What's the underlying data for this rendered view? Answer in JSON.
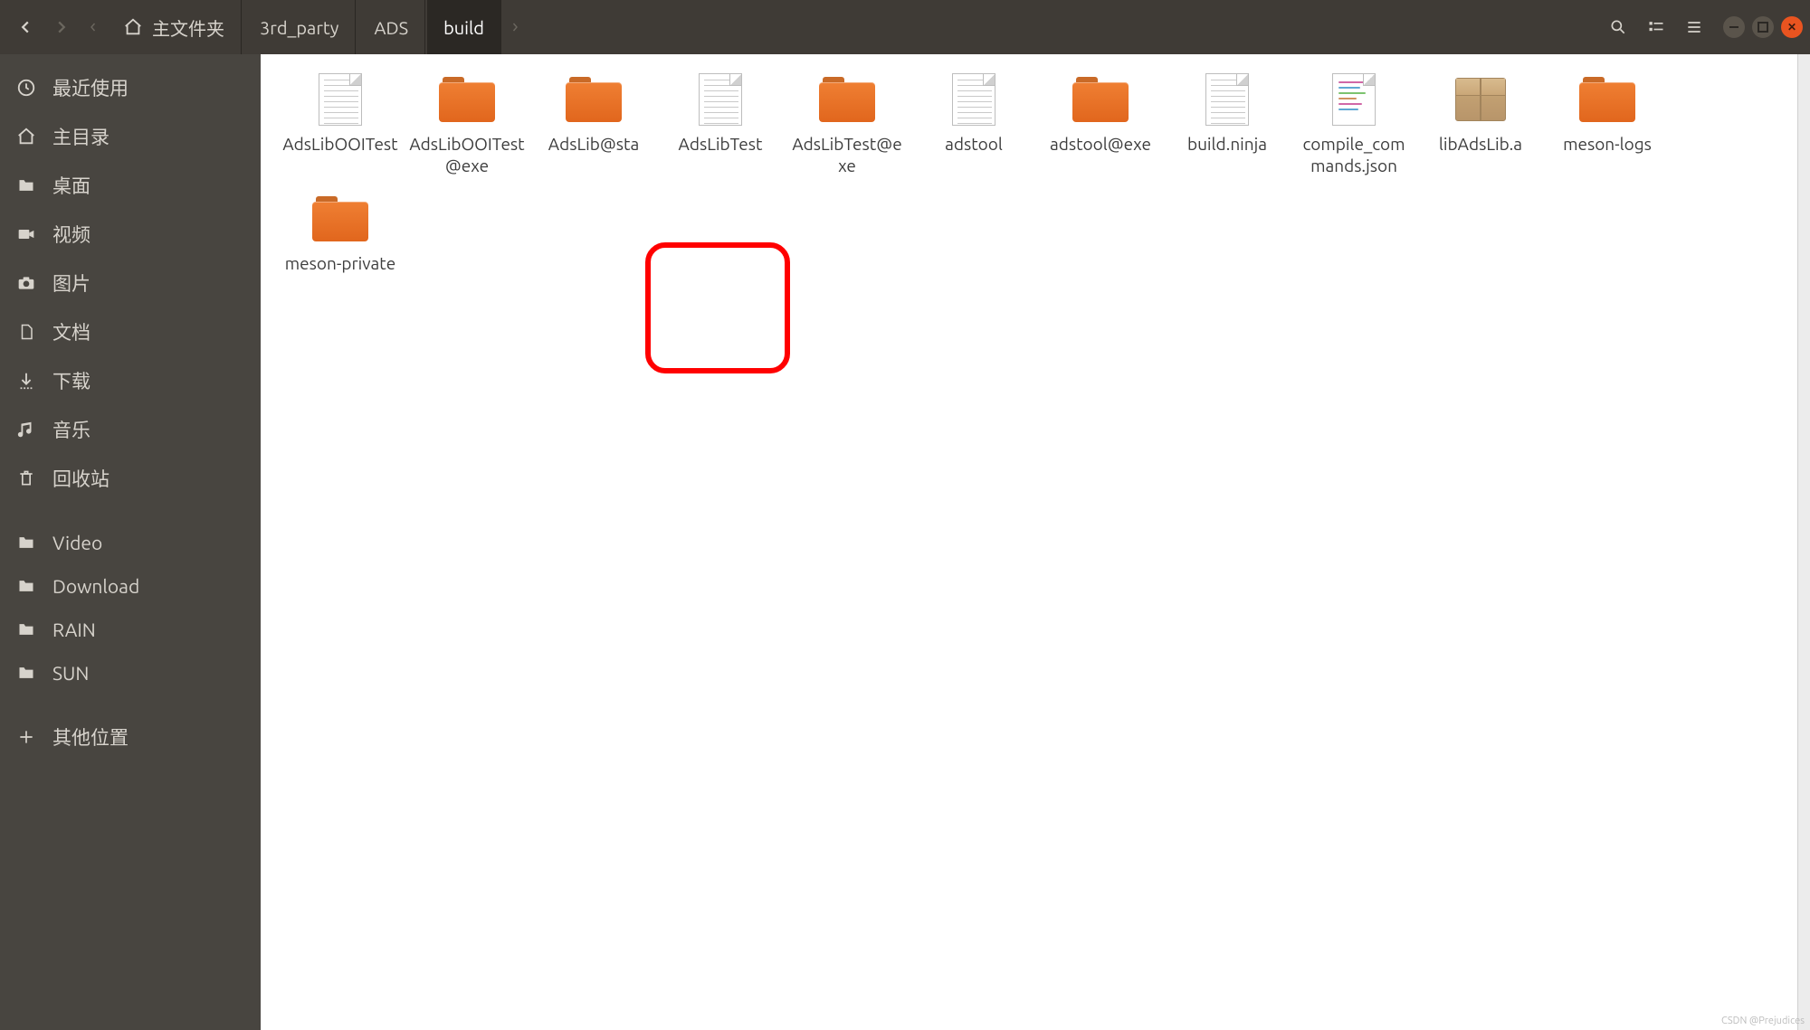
{
  "header": {
    "home_label": "主文件夹",
    "crumbs": [
      "3rd_party",
      "ADS",
      "build"
    ]
  },
  "sidebar": {
    "items": [
      {
        "icon": "recent",
        "label": "最近使用"
      },
      {
        "icon": "home",
        "label": "主目录"
      },
      {
        "icon": "folder",
        "label": "桌面"
      },
      {
        "icon": "video",
        "label": "视频"
      },
      {
        "icon": "camera",
        "label": "图片"
      },
      {
        "icon": "doc",
        "label": "文档"
      },
      {
        "icon": "download",
        "label": "下载"
      },
      {
        "icon": "music",
        "label": "音乐"
      },
      {
        "icon": "trash",
        "label": "回收站"
      }
    ],
    "items2": [
      {
        "icon": "folder",
        "label": "Video"
      },
      {
        "icon": "folder",
        "label": "Download"
      },
      {
        "icon": "folder",
        "label": "RAIN"
      },
      {
        "icon": "folder",
        "label": "SUN"
      }
    ],
    "other": {
      "icon": "plus",
      "label": "其他位置"
    }
  },
  "content": {
    "items": [
      {
        "type": "text",
        "label": "AdsLibOOITest"
      },
      {
        "type": "folder",
        "label": "AdsLibOOITest@exe"
      },
      {
        "type": "folder",
        "label": "AdsLib@sta"
      },
      {
        "type": "text",
        "label": "AdsLibTest"
      },
      {
        "type": "folder",
        "label": "AdsLibTest@exe"
      },
      {
        "type": "text",
        "label": "adstool"
      },
      {
        "type": "folder",
        "label": "adstool@exe"
      },
      {
        "type": "text",
        "label": "build.ninja"
      },
      {
        "type": "textcolor",
        "label": "compile_commands.json"
      },
      {
        "type": "archive",
        "label": "libAdsLib.a",
        "highlighted": true
      },
      {
        "type": "folder",
        "label": "meson-logs"
      },
      {
        "type": "folder",
        "label": "meson-private"
      }
    ]
  },
  "watermark": "CSDN @Prejudices"
}
